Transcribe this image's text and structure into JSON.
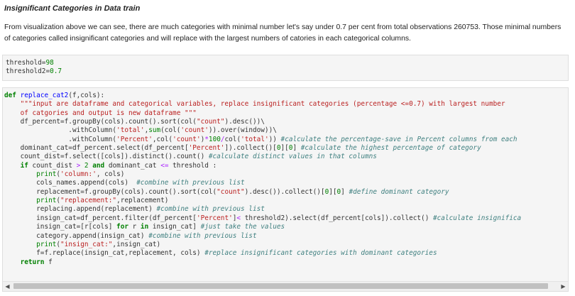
{
  "heading": "Insignificant Categories in Data train",
  "paragraph": "From visualization above we can see, there are much categories with minimal number let's say under 0.7 per cent from total observations 260753. Those minimal numbers of categories called insignificant categories and will replace with the largest numbers of catories in each categorical columns.",
  "cell1": {
    "line1_code": "threshold=",
    "line1_value": "98",
    "line2_code": "threshold2=",
    "line2_value": "0.7"
  },
  "cell2": {
    "code": "def replace_cat2(f,cols):\n    \"\"\"input are dataframe and categorical variables, replace insignificant categories (percentage <=0.7) with largest number\n    of catgories and output is new dataframe \"\"\"\n    df_percent=f.groupBy(cols).count().sort(col(\"count\").desc())\\\n                .withColumn('total',sum(col('count')).over(window))\\\n                .withColumn('Percent',col('count')*100/col('total')) #calculate the percentage-save in Percent columns from each\n    dominant_cat=df_percent.select(df_percent['Percent']).collect()[0][0] #calculate the highest percentage of category\n    count_dist=f.select([cols]).distinct().count() #calculate distinct values in that columns\n    if count_dist > 2 and dominant_cat <= threshold :\n        print('column:', cols)\n        cols_names.append(cols)  #combine with previous list\n        replacement=f.groupBy(cols).count().sort(col(\"count\").desc()).collect()[0][0] #define dominant category\n        print(\"replacement:\",replacement)\n        replacing.append(replacement) #combine with previous list\n        insign_cat=df_percent.filter(df_percent['Percent']< threshold2).select(df_percent[cols]).collect() #calculate insignifica\n        insign_cat=[r[cols] for r in insign_cat] #just take the values\n        category.append(insign_cat) #combine with previous list\n        print(\"insign_cat:\",insign_cat)\n        f=f.replace(insign_cat,replacement, cols) #replace insignificant categories with dominant categories\n    return f"
  },
  "scrollbar": {
    "left_arrow": "◀",
    "right_arrow": "▶"
  },
  "colors": {
    "keyword": "#008000",
    "function_name": "#0000ff",
    "string": "#ba2121",
    "comment": "#408080",
    "operator": "#aa22ff",
    "cell_background": "#f5f5f5"
  }
}
